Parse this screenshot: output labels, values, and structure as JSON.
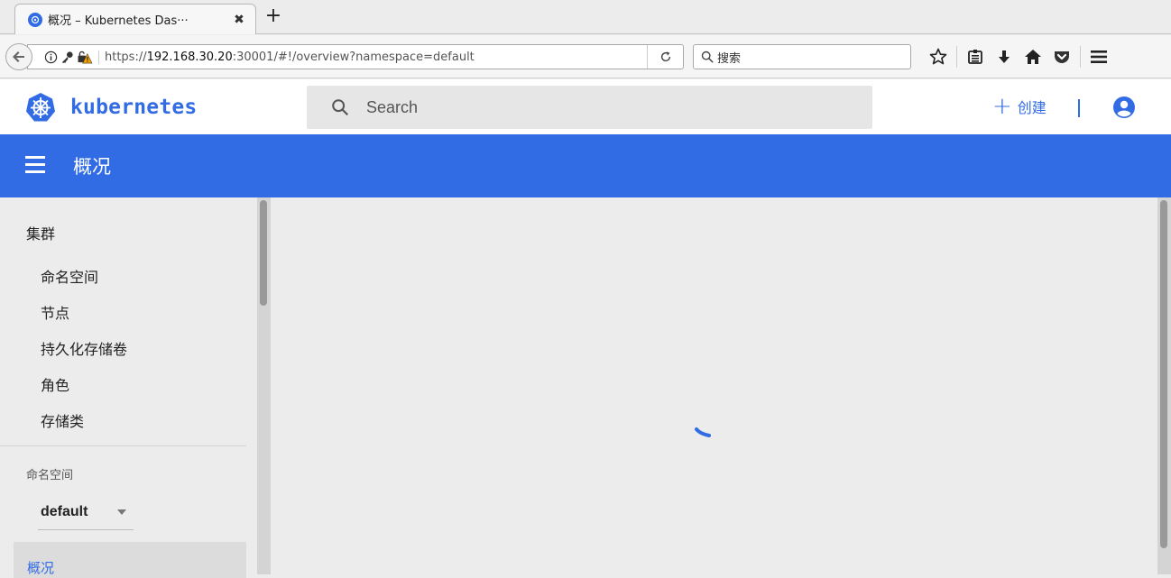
{
  "browser": {
    "tab_title": "概况 – Kubernetes Das···",
    "new_tab_symbol": "+",
    "close_symbol": "✖",
    "url_prefix": "https://",
    "url_host": "192.168.30.20",
    "url_rest": ":30001/#!/overview?namespace=default",
    "search_placeholder": "搜索"
  },
  "header": {
    "brand": "kubernetes",
    "search_placeholder": "Search",
    "create_label": "创建",
    "create_symbol": "+"
  },
  "toolbar": {
    "title": "概况"
  },
  "sidebar": {
    "cluster_heading": "集群",
    "cluster_items": [
      "命名空间",
      "节点",
      "持久化存储卷",
      "角色",
      "存储类"
    ],
    "namespace_label": "命名空间",
    "namespace_value": "default",
    "active_item": "概况"
  },
  "colors": {
    "brand": "#326ce5",
    "toolbar_bg": "#326ce5",
    "content_bg": "#ececec"
  },
  "icons": {
    "tab_favicon": "kubernetes-helm-icon",
    "back": "arrow-left-icon",
    "reload": "reload-icon",
    "search": "search-icon",
    "account": "account-circle-icon",
    "menu": "hamburger-icon"
  }
}
